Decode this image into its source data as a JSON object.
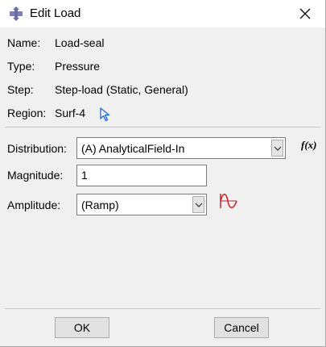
{
  "window": {
    "title": "Edit Load"
  },
  "info": {
    "name_label": "Name:",
    "name_value": "Load-seal",
    "type_label": "Type:",
    "type_value": "Pressure",
    "step_label": "Step:",
    "step_value": "Step-load (Static, General)",
    "region_label": "Region:",
    "region_value": "Surf-4"
  },
  "form": {
    "distribution_label": "Distribution:",
    "distribution_value": "(A) AnalyticalField-In",
    "fx_label": "f(x)",
    "magnitude_label": "Magnitude:",
    "magnitude_value": "1",
    "amplitude_label": "Amplitude:",
    "amplitude_value": "(Ramp)"
  },
  "buttons": {
    "ok": "OK",
    "cancel": "Cancel"
  },
  "colors": {
    "cursor_icon": "#2a6fd6",
    "amplitude_icon": "#c0262d"
  }
}
